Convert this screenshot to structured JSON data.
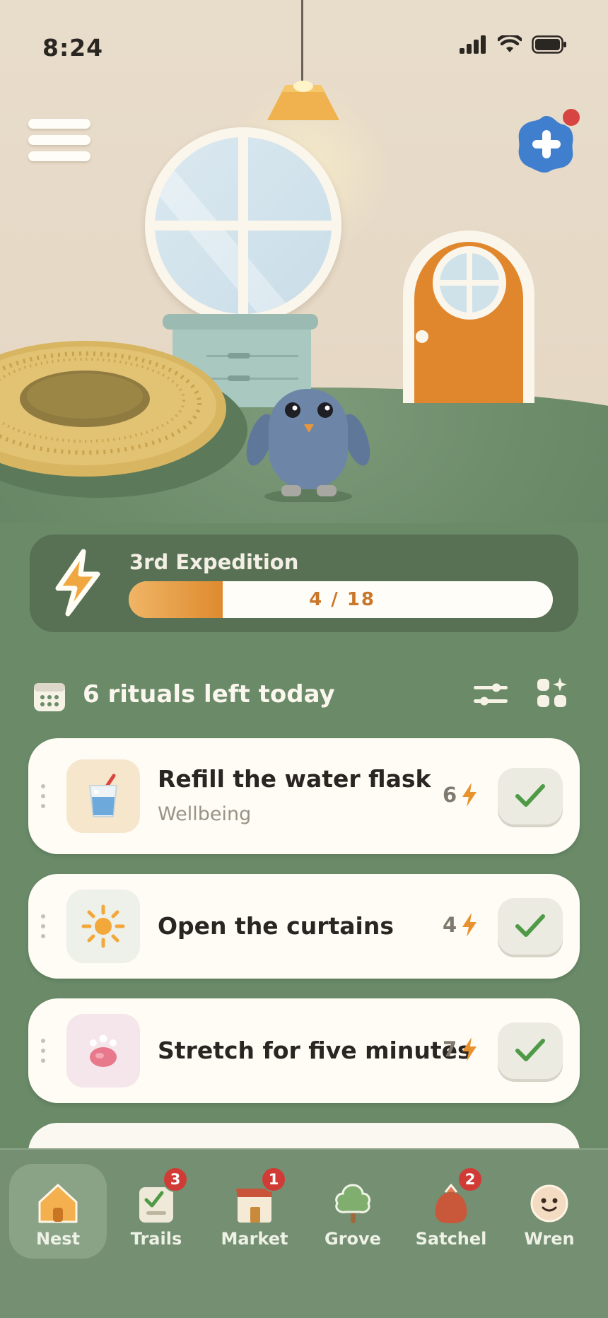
{
  "status_bar": {
    "time": "8:24",
    "icons": [
      "signal-icon",
      "wifi-icon",
      "battery-icon"
    ]
  },
  "scene": {
    "menu_icon": "hamburger-menu-icon",
    "add_icon": "plus-icon",
    "add_has_notification": true
  },
  "expedition": {
    "title": "3rd Expedition",
    "progress_text": "4 / 18",
    "current": 4,
    "total": 18
  },
  "rituals": {
    "header": "6 rituals left today",
    "items": [
      {
        "title": "Refill the water flask",
        "category": "Wellbeing",
        "points": "6",
        "icon": "water-glass-icon",
        "icon_bg": "#f5e6cc"
      },
      {
        "title": "Open the curtains",
        "category": "",
        "points": "4",
        "icon": "sun-icon",
        "icon_bg": "#eef0ea"
      },
      {
        "title": "Stretch for five minutes",
        "category": "",
        "points": "7",
        "icon": "paw-icon",
        "icon_bg": "#f4e6ea"
      }
    ]
  },
  "tabs": [
    {
      "label": "Nest",
      "icon": "house-icon",
      "badge": "",
      "active": true
    },
    {
      "label": "Trails",
      "icon": "checklist-icon",
      "badge": "3",
      "active": false
    },
    {
      "label": "Market",
      "icon": "shop-icon",
      "badge": "1",
      "active": false
    },
    {
      "label": "Grove",
      "icon": "tree-icon",
      "badge": "",
      "active": false
    },
    {
      "label": "Satchel",
      "icon": "bag-icon",
      "badge": "2",
      "active": false
    },
    {
      "label": "Wren",
      "icon": "face-icon",
      "badge": "",
      "active": false
    }
  ],
  "colors": {
    "accent": "#e08a2c",
    "check": "#4f9a47",
    "background": "#6a8a68",
    "badge": "#d13b36"
  }
}
